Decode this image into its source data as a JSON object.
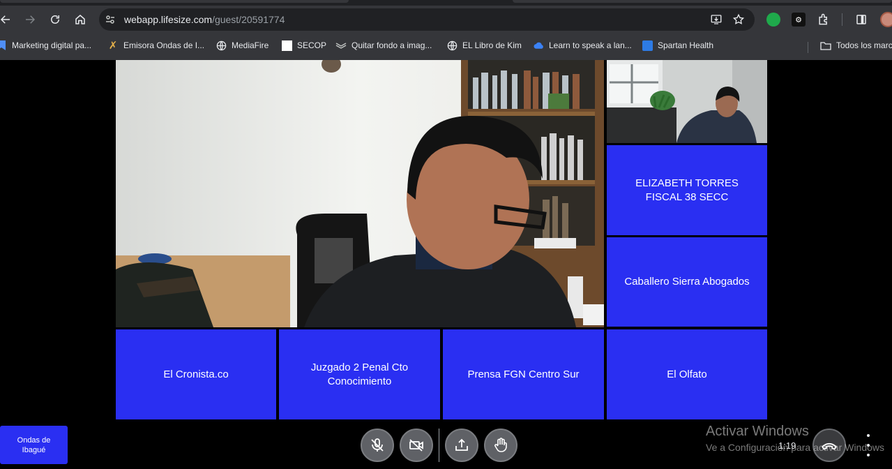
{
  "browser": {
    "url_host": "webapp.lifesize.com",
    "url_path": "/guest/20591774",
    "bookmarks": [
      {
        "label": "Marketing digital pa...",
        "icon": "bookmark-favicon"
      },
      {
        "label": "Emisora Ondas de I...",
        "icon": "radio-favicon"
      },
      {
        "label": "MediaFire",
        "icon": "globe-icon"
      },
      {
        "label": "SECOP",
        "icon": "blank-page-icon"
      },
      {
        "label": "Quitar fondo a imag...",
        "icon": "layers-icon"
      },
      {
        "label": "EL Libro de Kim",
        "icon": "globe-icon"
      },
      {
        "label": "Learn to speak a lan...",
        "icon": "cloud-icon"
      },
      {
        "label": "Spartan Health",
        "icon": "spartan-favicon"
      }
    ],
    "all_bookmarks_label": "Todos los marc"
  },
  "meeting": {
    "participants": [
      {
        "name": "ELIZABETH TORRES FISCAL 38 SECC"
      },
      {
        "name": "Caballero Sierra Abogados"
      },
      {
        "name": "El Cronista.co"
      },
      {
        "name": "Juzgado 2 Penal Cto Conocimiento"
      },
      {
        "name": "Prensa FGN Centro Sur"
      },
      {
        "name": "El Olfato"
      }
    ],
    "self_badge": "Ondas de Ibagué",
    "timer": "1:19"
  },
  "watermark": {
    "title": "Activar Windows",
    "subtitle": "Ve a Configuración para activar Windows"
  },
  "colors": {
    "tile_blue": "#2a2ff2",
    "chrome_bg": "#35363a",
    "omnibox_bg": "#202124"
  }
}
